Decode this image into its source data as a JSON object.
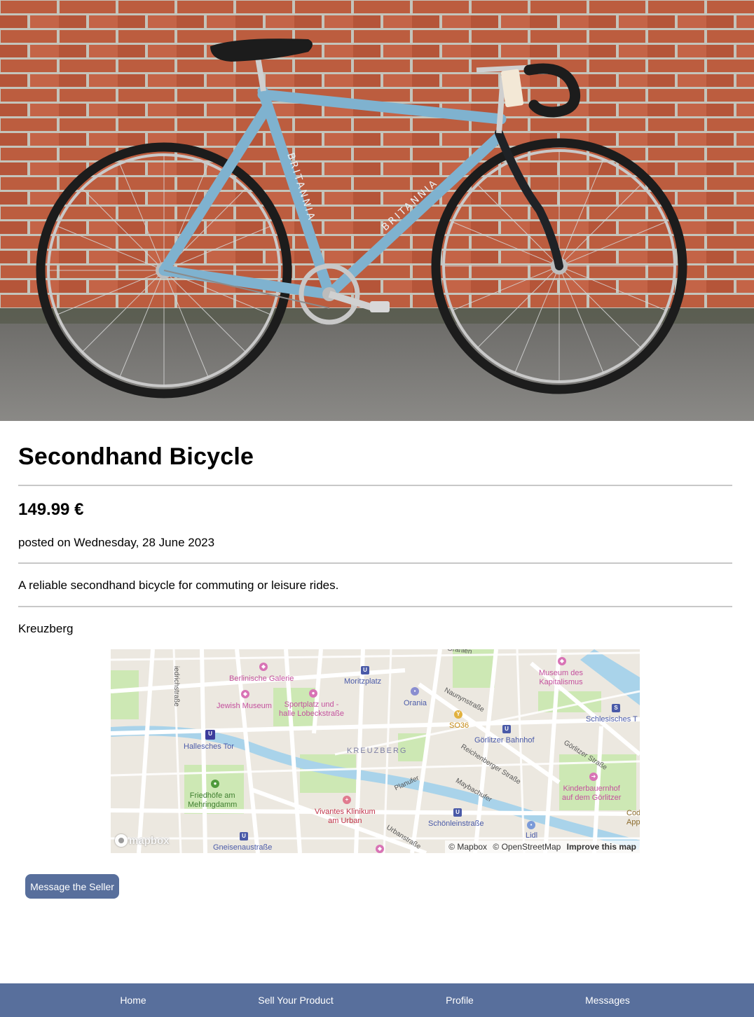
{
  "product": {
    "title": "Secondhand Bicycle",
    "price": "149.99 €",
    "posted": "posted on Wednesday, 28 June 2023",
    "description": "A reliable secondhand bicycle for commuting or leisure rides.",
    "location": "Kreuzberg"
  },
  "photo": {
    "frame_brand": "BRITANNIA"
  },
  "map": {
    "district": "KREUZBERG",
    "places": {
      "berlinische_galerie": "Berlinische Galerie",
      "jewish_museum": "Jewish Museum",
      "sportplatz": "Sportplatz und -\nhalle Lobeckstraße",
      "moritzplatz": "Moritzplatz",
      "orania": "Orania",
      "so36": "SO36",
      "museum_kapitalismus": "Museum des\nKapitalismus",
      "schlesisches_tor": "Schlesisches T",
      "goerlitzer_bahnhof": "Görlitzer Bahnhof",
      "hallesches_tor": "Hallesches Tor",
      "friedhoefe": "Friedhöfe am\nMehringdamm",
      "vivantes": "Vivantes Klinikum\nam Urban",
      "schoenleinstrasse": "Schönleinstraße",
      "kinderbauernhof": "Kinderbauernhof\nauf dem Görlitzer",
      "lidl": "Lidl",
      "gneisenaustrasse": "Gneisenaustraße",
      "code_app": "Cod\nApp"
    },
    "streets": {
      "naunynstrasse": "Naunynstraße",
      "reichenberger": "Reichenberger Straße",
      "goerlitzer_strasse": "Görlitzer Straße",
      "maybachufer": "Maybachufer",
      "planufer": "Planufer",
      "urbanstrasse": "Urbanstraße",
      "friedrichstrasse": "iedrichstraße",
      "oranienstrasse": "Oranien"
    },
    "logo": "mapbox",
    "attribution": {
      "mapbox": "© Mapbox",
      "osm": "© OpenStreetMap",
      "improve": "Improve this map"
    }
  },
  "actions": {
    "message_seller": "Message the Seller"
  },
  "nav": {
    "home": "Home",
    "sell": "Sell Your Product",
    "profile": "Profile",
    "messages": "Messages"
  },
  "colors": {
    "accent": "#586f9c",
    "bike_frame": "#7fb2cf",
    "brick": "#b5533a"
  }
}
